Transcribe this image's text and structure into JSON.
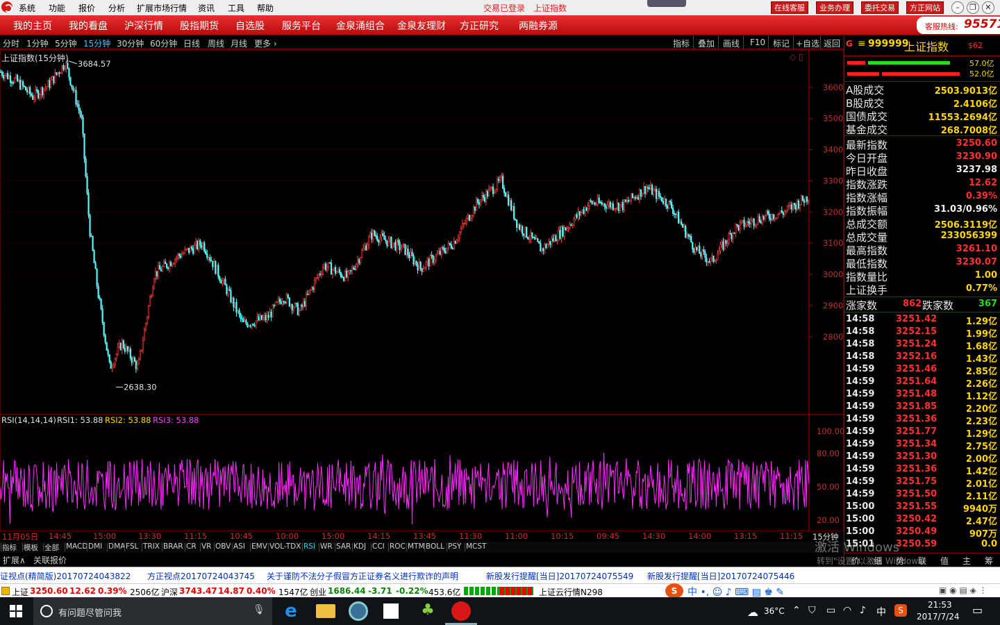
{
  "menu": {
    "items": [
      "系统",
      "功能",
      "报价",
      "分析",
      "扩展市场行情",
      "资讯",
      "工具",
      "帮助"
    ],
    "status_trade": "交易已登录",
    "status_index": "上证指数",
    "top_buttons": [
      "在线客服",
      "业务办理",
      "委托交易",
      "方正网站"
    ]
  },
  "nav": {
    "items": [
      "我的主页",
      "我的看盘",
      "沪深行情",
      "股指期货",
      "自选股",
      "服务平台",
      "金泉涌组合",
      "金泉友理财",
      "方正研究",
      "两融券源"
    ],
    "hotline_label": "客服热线:",
    "hotline_number": "95571"
  },
  "period": {
    "items": [
      "分时",
      "1分钟",
      "5分钟",
      "15分钟",
      "30分钟",
      "60分钟",
      "日线",
      "周线",
      "月线",
      "更多 ›"
    ],
    "active": "15分钟",
    "tools": [
      "指标",
      "叠加",
      "画线",
      "F10",
      "标记",
      "+自选",
      "返回"
    ]
  },
  "chart_title": "上证指数(15分钟)",
  "rsi_label": "RSI(14,14,14)",
  "rsi1": "RSI1: 53.88",
  "rsi2": "RSI2: 53.88",
  "rsi3": "RSI3: 53.88",
  "chart_data": [
    {
      "type": "candlestick",
      "title": "上证指数(15分钟)",
      "ylim": [
        2550,
        3720
      ],
      "y_ticks": [
        2800,
        2900,
        3000,
        3100,
        3200,
        3300,
        3400,
        3500,
        3600
      ],
      "annotations": [
        {
          "label": "3684.57",
          "value": 3684.57
        },
        {
          "label": "2638.30",
          "value": 2638.3
        }
      ],
      "trend_anchors": [
        [
          0,
          3650
        ],
        [
          0.02,
          3620
        ],
        [
          0.04,
          3570
        ],
        [
          0.06,
          3610
        ],
        [
          0.08,
          3680
        ],
        [
          0.1,
          3500
        ],
        [
          0.11,
          3150
        ],
        [
          0.12,
          2950
        ],
        [
          0.135,
          2700
        ],
        [
          0.15,
          2780
        ],
        [
          0.17,
          2700
        ],
        [
          0.19,
          3000
        ],
        [
          0.22,
          3060
        ],
        [
          0.25,
          3100
        ],
        [
          0.28,
          2950
        ],
        [
          0.3,
          2840
        ],
        [
          0.33,
          2860
        ],
        [
          0.35,
          2930
        ],
        [
          0.37,
          2880
        ],
        [
          0.4,
          3030
        ],
        [
          0.43,
          2990
        ],
        [
          0.46,
          3130
        ],
        [
          0.5,
          3080
        ],
        [
          0.52,
          3020
        ],
        [
          0.56,
          3100
        ],
        [
          0.59,
          3230
        ],
        [
          0.62,
          3300
        ],
        [
          0.64,
          3160
        ],
        [
          0.67,
          3080
        ],
        [
          0.7,
          3150
        ],
        [
          0.73,
          3230
        ],
        [
          0.77,
          3220
        ],
        [
          0.8,
          3280
        ],
        [
          0.83,
          3220
        ],
        [
          0.86,
          3080
        ],
        [
          0.88,
          3040
        ],
        [
          0.91,
          3150
        ],
        [
          0.94,
          3180
        ],
        [
          0.97,
          3200
        ],
        [
          1,
          3250
        ]
      ]
    },
    {
      "type": "line",
      "title": "RSI(14,14,14)",
      "ylim": [
        10,
        105
      ],
      "y_ticks": [
        20.0,
        50.0,
        80.0,
        100.0
      ]
    }
  ],
  "x_ticks": [
    "11月05日",
    "14:45",
    "15:00",
    "13:30",
    "11:15",
    "10:45",
    "10:00",
    "15:00",
    "14:15",
    "13:45",
    "11:30",
    "11:00",
    "10:15",
    "09:45",
    "14:30",
    "14:00",
    "13:15",
    "11:15"
  ],
  "x_period": "15分钟",
  "indicators": [
    "指标",
    "模板",
    "全部",
    "MACD",
    "DMI",
    "DMA",
    "FSL",
    "TRIX",
    "BRAR",
    "CR",
    "VR",
    "OBV",
    "ASI",
    "EMV",
    "VOL-TDX",
    "RSI",
    "WR",
    "SAR",
    "KDJ",
    "CCI",
    "ROC",
    "MTM",
    "BOLL",
    "PSY",
    "MCST"
  ],
  "ext": {
    "expand": "扩展∧",
    "linked": "关联报价"
  },
  "right": {
    "code": "999999",
    "name": "上证指数",
    "badge": "$62",
    "bar1": "57.0亿",
    "bar2": "52.0亿",
    "turnover": [
      {
        "label": "A股成交",
        "value": "2503.9013亿"
      },
      {
        "label": "B股成交",
        "value": "2.4106亿"
      },
      {
        "label": "国债成交",
        "value": "11553.2694亿"
      },
      {
        "label": "基金成交",
        "value": "268.7008亿"
      }
    ],
    "stats": [
      {
        "label": "最新指数",
        "value": "3250.60",
        "color": "#ff3030"
      },
      {
        "label": "今日开盘",
        "value": "3230.90",
        "color": "#ff3030"
      },
      {
        "label": "昨日收盘",
        "value": "3237.98",
        "color": "#f0f0f0"
      },
      {
        "label": "指数涨跌",
        "value": "12.62",
        "color": "#ff3030"
      },
      {
        "label": "指数涨幅",
        "value": "0.39%",
        "color": "#ff3030"
      },
      {
        "label": "指数振幅",
        "value": "31.03/0.96%",
        "color": "#f0f0f0"
      },
      {
        "label": "总成交额",
        "value": "2506.3119亿",
        "color": "#ffd700"
      },
      {
        "label": "总成交量",
        "value": "233056399",
        "color": "#ffd700"
      },
      {
        "label": "最高指数",
        "value": "3261.10",
        "color": "#ff3030"
      },
      {
        "label": "最低指数",
        "value": "3230.07",
        "color": "#ff3030"
      },
      {
        "label": "指数量比",
        "value": "1.00",
        "color": "#ffd700"
      },
      {
        "label": "上证换手",
        "value": "0.77%",
        "color": "#ffd700"
      }
    ],
    "up_label": "涨家数",
    "up": "862",
    "down_label": "跌家数",
    "down": "367",
    "ticks": [
      [
        "14:58",
        "3251.42",
        "1.29亿"
      ],
      [
        "14:58",
        "3252.15",
        "1.99亿"
      ],
      [
        "14:58",
        "3251.24",
        "1.68亿"
      ],
      [
        "14:58",
        "3252.16",
        "1.43亿"
      ],
      [
        "14:59",
        "3251.46",
        "2.85亿"
      ],
      [
        "14:59",
        "3251.64",
        "2.26亿"
      ],
      [
        "14:59",
        "3251.48",
        "1.12亿"
      ],
      [
        "14:59",
        "3251.85",
        "2.20亿"
      ],
      [
        "14:59",
        "3251.36",
        "2.23亿"
      ],
      [
        "14:59",
        "3251.77",
        "1.29亿"
      ],
      [
        "14:59",
        "3251.34",
        "2.75亿"
      ],
      [
        "14:59",
        "3251.30",
        "2.00亿"
      ],
      [
        "14:59",
        "3251.36",
        "1.42亿"
      ],
      [
        "14:59",
        "3251.75",
        "2.01亿"
      ],
      [
        "14:59",
        "3251.50",
        "2.11亿"
      ],
      [
        "15:00",
        "3251.55",
        "9940万"
      ],
      [
        "15:00",
        "3250.42",
        "2.47亿"
      ],
      [
        "15:00",
        "3250.49",
        "907万"
      ],
      [
        "15:01",
        "3250.59",
        "0.0"
      ]
    ],
    "watermark1": "激活 Windows",
    "watermark2": "转到\"设置\"以激活 Windows。",
    "bottom_tabs": [
      "价",
      "细",
      "势",
      "联",
      "值",
      "主",
      "筹"
    ]
  },
  "news": [
    "证视点(精简版)20170724043822",
    "方正视点20170724043745",
    "关于谨防不法分子假冒方正证券名义进行欺诈的声明",
    "新股发行提醒[当日]20170724075549",
    "新股发行提醒[当日]20170724075446"
  ],
  "index_bar": [
    {
      "name": "上证",
      "value": "3250.60",
      "chg": "12.62",
      "pct": "0.39%",
      "amt": "2506亿"
    },
    {
      "name": "沪深",
      "value": "3743.47",
      "chg": "14.87",
      "pct": "0.40%",
      "amt": "1547亿"
    },
    {
      "name": "创业",
      "value": "1686.44",
      "chg": "-3.71",
      "pct": "-0.22%",
      "amt": "453.6亿"
    }
  ],
  "cloud": "上证云行情N298",
  "taskbar": {
    "search": "有问题尽管问我",
    "temp": "36°C",
    "ime": "中",
    "time": "21:53",
    "date": "2017/7/24"
  }
}
